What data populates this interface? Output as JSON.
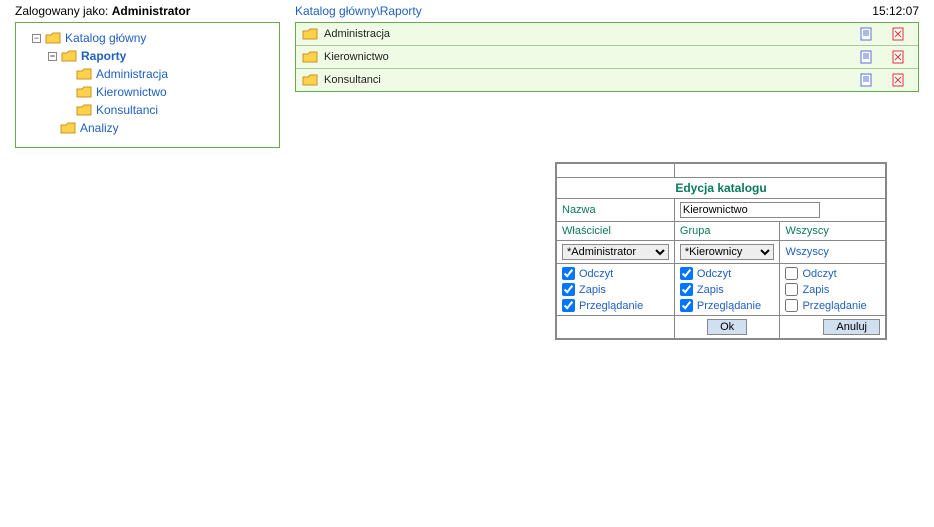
{
  "header": {
    "login_prefix": "Zalogowany jako: ",
    "user": "Administrator",
    "breadcrumb": "Katalog główny\\Raporty",
    "time": "15:12:07"
  },
  "tree": {
    "root": {
      "label": "Katalog główny"
    },
    "raporty": {
      "label": "Raporty"
    },
    "administracja": {
      "label": "Administracja"
    },
    "kierownictwo": {
      "label": "Kierownictwo"
    },
    "konsultanci": {
      "label": "Konsultanci"
    },
    "analizy": {
      "label": "Analizy"
    }
  },
  "list": {
    "items": [
      {
        "name": "Administracja"
      },
      {
        "name": "Kierownictwo"
      },
      {
        "name": "Konsultanci"
      }
    ]
  },
  "dialog": {
    "title": "Edycja katalogu",
    "name_label": "Nazwa",
    "name_value": "Kierownictwo",
    "owner_label": "Właściciel",
    "group_label": "Grupa",
    "all_label": "Wszyscy",
    "owner_select": "*Administrator",
    "group_select": "*Kierownicy",
    "all_static": "Wszyscy",
    "perms": {
      "read": "Odczyt",
      "write": "Zapis",
      "browse": "Przeglądanie"
    },
    "owner_perms": {
      "read": true,
      "write": true,
      "browse": true
    },
    "group_perms": {
      "read": true,
      "write": true,
      "browse": true
    },
    "all_perms": {
      "read": false,
      "write": false,
      "browse": false
    },
    "ok": "Ok",
    "cancel": "Anuluj"
  }
}
